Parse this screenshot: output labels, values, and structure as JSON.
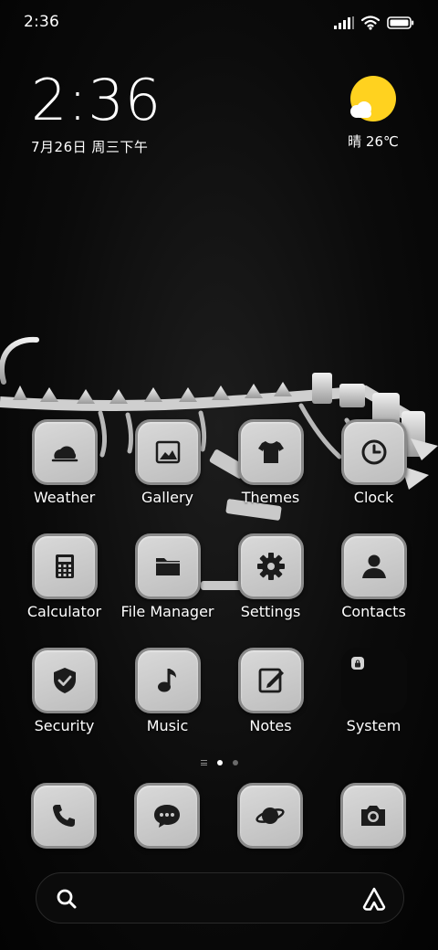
{
  "status_bar": {
    "time": "2:36",
    "icons": [
      "signal-icon",
      "wifi-icon",
      "battery-icon"
    ]
  },
  "clock_widget": {
    "time": "2:36",
    "date": "7月26日 周三下午"
  },
  "weather_widget": {
    "condition_icon": "sun-cloud-icon",
    "text": "晴 26℃"
  },
  "apps": [
    {
      "label": "Weather",
      "icon": "weather-icon"
    },
    {
      "label": "Gallery",
      "icon": "gallery-icon"
    },
    {
      "label": "Themes",
      "icon": "themes-icon"
    },
    {
      "label": "Clock",
      "icon": "clock-icon"
    },
    {
      "label": "Calculator",
      "icon": "calculator-icon"
    },
    {
      "label": "File Manager",
      "icon": "folder-icon"
    },
    {
      "label": "Settings",
      "icon": "gear-icon"
    },
    {
      "label": "Contacts",
      "icon": "contacts-icon"
    },
    {
      "label": "Security",
      "icon": "shield-icon"
    },
    {
      "label": "Music",
      "icon": "music-note-icon"
    },
    {
      "label": "Notes",
      "icon": "notes-icon"
    },
    {
      "label": "System",
      "icon": "folder-group-icon"
    }
  ],
  "page_indicator": {
    "pages": 2,
    "current": 1
  },
  "dock": [
    {
      "icon": "phone-icon"
    },
    {
      "icon": "messages-icon"
    },
    {
      "icon": "browser-planet-icon"
    },
    {
      "icon": "camera-icon"
    }
  ],
  "search_bar": {
    "left_icon": "search-icon",
    "right_icon": "assistant-icon"
  },
  "colors": {
    "background": "#050505",
    "icon_tile": "#c9c9c9",
    "icon_border": "#8a8a8a",
    "glyph": "#1c1c1c",
    "sun": "#ffd21f"
  }
}
